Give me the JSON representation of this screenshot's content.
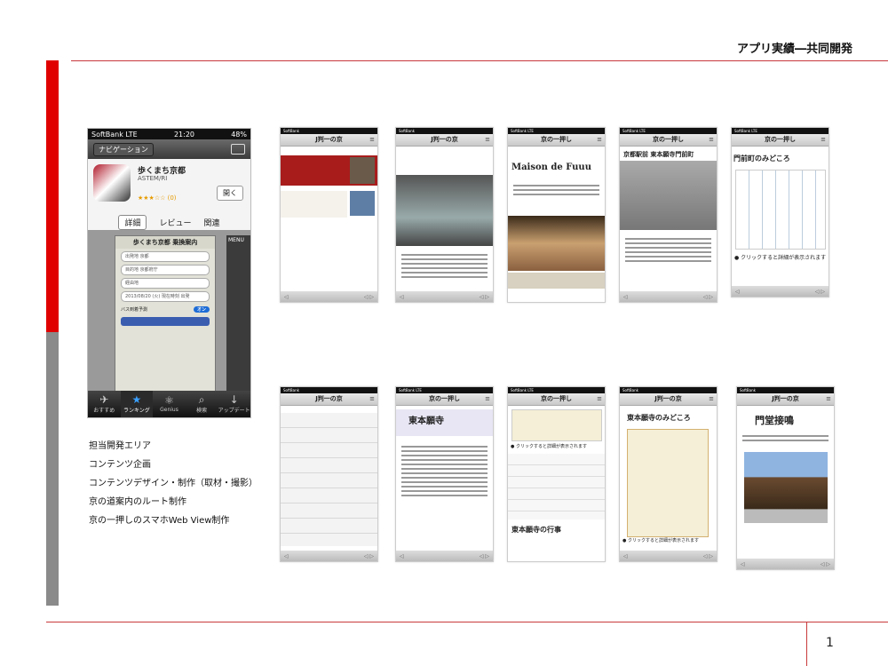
{
  "header": {
    "title": "アプリ実績―共同開発"
  },
  "page_number": "1",
  "app_screenshot": {
    "status": {
      "carrier": "SoftBank  LTE",
      "time": "21:20",
      "battery": "48%"
    },
    "nav_button": "ナビゲーション",
    "app_name": "歩くまち京都",
    "developer": "ASTEM/RI",
    "rating": "★★★☆☆ (0)",
    "open_button": "開く",
    "tabs": [
      "詳細",
      "レビュー",
      "関連"
    ],
    "preview": {
      "title": "歩くまち京都  乗換案内",
      "fields": [
        "出発地 京都",
        "目的地 京都府庁",
        "経由地",
        "2013/08/20 (火) 現在時刻 出発"
      ],
      "toggle_label": "バス到着予測",
      "toggle_value": "オン",
      "menu_label": "MENU"
    },
    "tabbar": [
      {
        "icon": "✈",
        "label": "おすすめ"
      },
      {
        "icon": "★",
        "label": "ランキング"
      },
      {
        "icon": "⚛",
        "label": "Genius"
      },
      {
        "icon": "⌕",
        "label": "検索"
      },
      {
        "icon": "↓",
        "label": "アップデート"
      }
    ]
  },
  "responsibilities": [
    "担当開発エリア",
    "コンテンツ企画",
    "コンテンツデザイン・制作（取材・撮影）",
    "京の道案内のルート制作",
    "京の一押しのスマホWeb View制作"
  ],
  "thumbnails": [
    {
      "title": "J判一の京",
      "status": "SoftBank"
    },
    {
      "title": "J判一の京",
      "status": "SoftBank"
    },
    {
      "title": "京の一押し",
      "status": "SoftBank LTE",
      "heading": "Maison de Fuuu"
    },
    {
      "title": "京の一押し",
      "status": "SoftBank LTE",
      "heading": "京都駅前 東本願寺門前町"
    },
    {
      "title": "京の一押し",
      "status": "SoftBank LTE",
      "heading": "門前町のみどころ",
      "caption": "● クリックすると詳細が表示されます"
    },
    {
      "title": "J判一の京",
      "status": "SoftBank"
    },
    {
      "title": "京の一押し",
      "status": "SoftBank LTE",
      "heading": "東本願寺"
    },
    {
      "title": "京の一押し",
      "status": "SoftBank LTE",
      "caption": "● クリックすると詳細が表示されます",
      "heading": "東本願寺の行事"
    },
    {
      "title": "J判一の京",
      "status": "SoftBank",
      "heading": "東本願寺のみどころ",
      "caption": "● クリックすると詳細が表示されます"
    },
    {
      "title": "J判一の京",
      "status": "SoftBank",
      "heading": "門堂接鳴"
    }
  ]
}
